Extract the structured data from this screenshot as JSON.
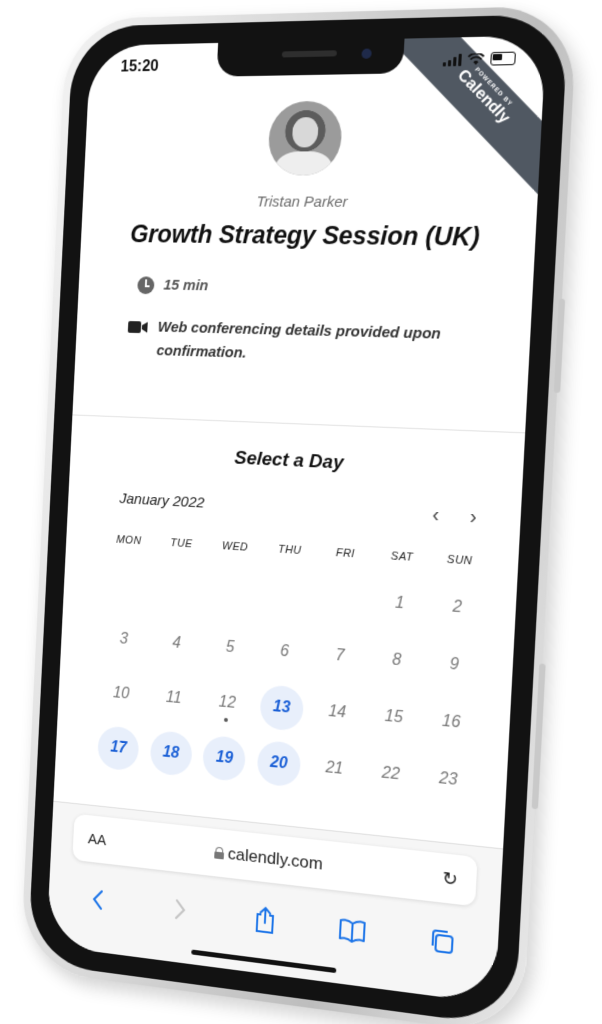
{
  "status_bar": {
    "time": "15:20"
  },
  "ribbon": {
    "small": "POWERED BY",
    "brand": "Calendly"
  },
  "event": {
    "organizer": "Tristan Parker",
    "title": "Growth Strategy Session (UK)",
    "duration": "15 min",
    "conferencing": "Web conferencing details provided upon confirmation."
  },
  "calendar": {
    "section_title": "Select a Day",
    "month": "January 2022",
    "prev": "‹",
    "next": "›",
    "weekdays": [
      "MON",
      "TUE",
      "WED",
      "THU",
      "FRI",
      "SAT",
      "SUN"
    ],
    "leading_blanks": 5,
    "days": [
      {
        "n": "1"
      },
      {
        "n": "2"
      },
      {
        "n": "3"
      },
      {
        "n": "4"
      },
      {
        "n": "5"
      },
      {
        "n": "6"
      },
      {
        "n": "7"
      },
      {
        "n": "8"
      },
      {
        "n": "9"
      },
      {
        "n": "10"
      },
      {
        "n": "11"
      },
      {
        "n": "12",
        "today": true
      },
      {
        "n": "13",
        "available": true
      },
      {
        "n": "14"
      },
      {
        "n": "15"
      },
      {
        "n": "16"
      },
      {
        "n": "17",
        "available": true
      },
      {
        "n": "18",
        "available": true
      },
      {
        "n": "19",
        "available": true
      },
      {
        "n": "20",
        "available": true
      },
      {
        "n": "21"
      },
      {
        "n": "22"
      },
      {
        "n": "23"
      }
    ]
  },
  "browser": {
    "text_size": "AA",
    "url": "calendly.com",
    "reload": "↻"
  },
  "colors": {
    "accent": "#1a5fd6",
    "available_bg": "#e8effb",
    "ribbon_bg": "#505862",
    "toolbar_icon": "#1a73e8"
  }
}
